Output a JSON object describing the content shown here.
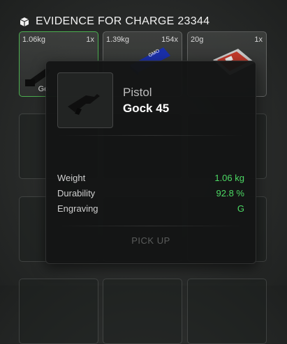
{
  "header": {
    "title": "EVIDENCE FOR CHARGE 23344",
    "icon": "box-icon"
  },
  "slots": [
    {
      "weight": "1.06kg",
      "qty": "1x",
      "name": "Go",
      "icon": "pistol-icon"
    },
    {
      "weight": "1.39kg",
      "qty": "154x",
      "name": "",
      "icon": "ammo-box-icon"
    },
    {
      "weight": "20g",
      "qty": "1x",
      "name": "",
      "icon": "card-pack-icon"
    }
  ],
  "tooltip": {
    "category": "Pistol",
    "name": "Gock 45",
    "stats": [
      {
        "label": "Weight",
        "value": "1.06 kg"
      },
      {
        "label": "Durability",
        "value": "92.8 %"
      },
      {
        "label": "Engraving",
        "value": "G"
      }
    ],
    "action_label": "PICK UP"
  },
  "colors": {
    "accent_green": "#4cd964",
    "selected_border": "#4caf50"
  }
}
